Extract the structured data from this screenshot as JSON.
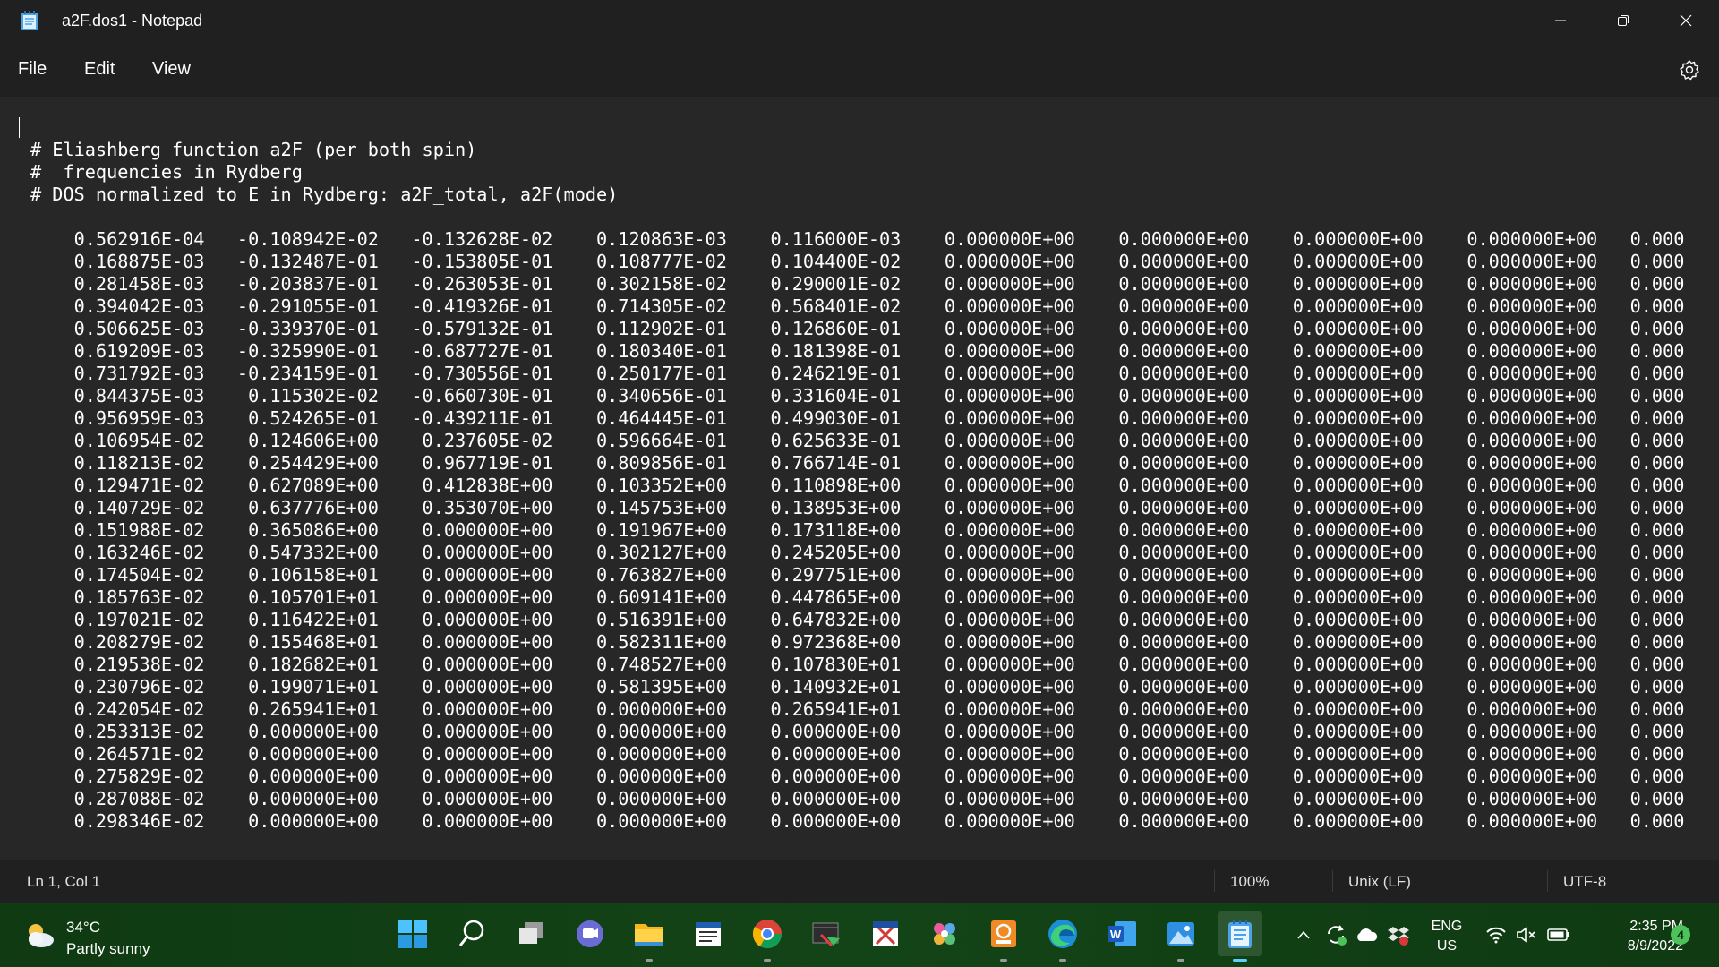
{
  "window": {
    "title": "a2F.dos1 - Notepad"
  },
  "menu": {
    "file": "File",
    "edit": "Edit",
    "view": "View"
  },
  "editor": {
    "header_lines": [
      "# Eliashberg function a2F (per both spin)",
      "#  frequencies in Rydberg",
      "# DOS normalized to E in Rydberg: a2F_total, a2F(mode)"
    ],
    "rows": [
      [
        "0.562916E-04",
        "-0.108942E-02",
        "-0.132628E-02",
        "0.120863E-03",
        "0.116000E-03",
        "0.000000E+00",
        "0.000000E+00",
        "0.000000E+00",
        "0.000000E+00",
        "0.000"
      ],
      [
        "0.168875E-03",
        "-0.132487E-01",
        "-0.153805E-01",
        "0.108777E-02",
        "0.104400E-02",
        "0.000000E+00",
        "0.000000E+00",
        "0.000000E+00",
        "0.000000E+00",
        "0.000"
      ],
      [
        "0.281458E-03",
        "-0.203837E-01",
        "-0.263053E-01",
        "0.302158E-02",
        "0.290001E-02",
        "0.000000E+00",
        "0.000000E+00",
        "0.000000E+00",
        "0.000000E+00",
        "0.000"
      ],
      [
        "0.394042E-03",
        "-0.291055E-01",
        "-0.419326E-01",
        "0.714305E-02",
        "0.568401E-02",
        "0.000000E+00",
        "0.000000E+00",
        "0.000000E+00",
        "0.000000E+00",
        "0.000"
      ],
      [
        "0.506625E-03",
        "-0.339370E-01",
        "-0.579132E-01",
        "0.112902E-01",
        "0.126860E-01",
        "0.000000E+00",
        "0.000000E+00",
        "0.000000E+00",
        "0.000000E+00",
        "0.000"
      ],
      [
        "0.619209E-03",
        "-0.325990E-01",
        "-0.687727E-01",
        "0.180340E-01",
        "0.181398E-01",
        "0.000000E+00",
        "0.000000E+00",
        "0.000000E+00",
        "0.000000E+00",
        "0.000"
      ],
      [
        "0.731792E-03",
        "-0.234159E-01",
        "-0.730556E-01",
        "0.250177E-01",
        "0.246219E-01",
        "0.000000E+00",
        "0.000000E+00",
        "0.000000E+00",
        "0.000000E+00",
        "0.000"
      ],
      [
        "0.844375E-03",
        "0.115302E-02",
        "-0.660730E-01",
        "0.340656E-01",
        "0.331604E-01",
        "0.000000E+00",
        "0.000000E+00",
        "0.000000E+00",
        "0.000000E+00",
        "0.000"
      ],
      [
        "0.956959E-03",
        "0.524265E-01",
        "-0.439211E-01",
        "0.464445E-01",
        "0.499030E-01",
        "0.000000E+00",
        "0.000000E+00",
        "0.000000E+00",
        "0.000000E+00",
        "0.000"
      ],
      [
        "0.106954E-02",
        "0.124606E+00",
        "0.237605E-02",
        "0.596664E-01",
        "0.625633E-01",
        "0.000000E+00",
        "0.000000E+00",
        "0.000000E+00",
        "0.000000E+00",
        "0.000"
      ],
      [
        "0.118213E-02",
        "0.254429E+00",
        "0.967719E-01",
        "0.809856E-01",
        "0.766714E-01",
        "0.000000E+00",
        "0.000000E+00",
        "0.000000E+00",
        "0.000000E+00",
        "0.000"
      ],
      [
        "0.129471E-02",
        "0.627089E+00",
        "0.412838E+00",
        "0.103352E+00",
        "0.110898E+00",
        "0.000000E+00",
        "0.000000E+00",
        "0.000000E+00",
        "0.000000E+00",
        "0.000"
      ],
      [
        "0.140729E-02",
        "0.637776E+00",
        "0.353070E+00",
        "0.145753E+00",
        "0.138953E+00",
        "0.000000E+00",
        "0.000000E+00",
        "0.000000E+00",
        "0.000000E+00",
        "0.000"
      ],
      [
        "0.151988E-02",
        "0.365086E+00",
        "0.000000E+00",
        "0.191967E+00",
        "0.173118E+00",
        "0.000000E+00",
        "0.000000E+00",
        "0.000000E+00",
        "0.000000E+00",
        "0.000"
      ],
      [
        "0.163246E-02",
        "0.547332E+00",
        "0.000000E+00",
        "0.302127E+00",
        "0.245205E+00",
        "0.000000E+00",
        "0.000000E+00",
        "0.000000E+00",
        "0.000000E+00",
        "0.000"
      ],
      [
        "0.174504E-02",
        "0.106158E+01",
        "0.000000E+00",
        "0.763827E+00",
        "0.297751E+00",
        "0.000000E+00",
        "0.000000E+00",
        "0.000000E+00",
        "0.000000E+00",
        "0.000"
      ],
      [
        "0.185763E-02",
        "0.105701E+01",
        "0.000000E+00",
        "0.609141E+00",
        "0.447865E+00",
        "0.000000E+00",
        "0.000000E+00",
        "0.000000E+00",
        "0.000000E+00",
        "0.000"
      ],
      [
        "0.197021E-02",
        "0.116422E+01",
        "0.000000E+00",
        "0.516391E+00",
        "0.647832E+00",
        "0.000000E+00",
        "0.000000E+00",
        "0.000000E+00",
        "0.000000E+00",
        "0.000"
      ],
      [
        "0.208279E-02",
        "0.155468E+01",
        "0.000000E+00",
        "0.582311E+00",
        "0.972368E+00",
        "0.000000E+00",
        "0.000000E+00",
        "0.000000E+00",
        "0.000000E+00",
        "0.000"
      ],
      [
        "0.219538E-02",
        "0.182682E+01",
        "0.000000E+00",
        "0.748527E+00",
        "0.107830E+01",
        "0.000000E+00",
        "0.000000E+00",
        "0.000000E+00",
        "0.000000E+00",
        "0.000"
      ],
      [
        "0.230796E-02",
        "0.199071E+01",
        "0.000000E+00",
        "0.581395E+00",
        "0.140932E+01",
        "0.000000E+00",
        "0.000000E+00",
        "0.000000E+00",
        "0.000000E+00",
        "0.000"
      ],
      [
        "0.242054E-02",
        "0.265941E+01",
        "0.000000E+00",
        "0.000000E+00",
        "0.265941E+01",
        "0.000000E+00",
        "0.000000E+00",
        "0.000000E+00",
        "0.000000E+00",
        "0.000"
      ],
      [
        "0.253313E-02",
        "0.000000E+00",
        "0.000000E+00",
        "0.000000E+00",
        "0.000000E+00",
        "0.000000E+00",
        "0.000000E+00",
        "0.000000E+00",
        "0.000000E+00",
        "0.000"
      ],
      [
        "0.264571E-02",
        "0.000000E+00",
        "0.000000E+00",
        "0.000000E+00",
        "0.000000E+00",
        "0.000000E+00",
        "0.000000E+00",
        "0.000000E+00",
        "0.000000E+00",
        "0.000"
      ],
      [
        "0.275829E-02",
        "0.000000E+00",
        "0.000000E+00",
        "0.000000E+00",
        "0.000000E+00",
        "0.000000E+00",
        "0.000000E+00",
        "0.000000E+00",
        "0.000000E+00",
        "0.000"
      ],
      [
        "0.287088E-02",
        "0.000000E+00",
        "0.000000E+00",
        "0.000000E+00",
        "0.000000E+00",
        "0.000000E+00",
        "0.000000E+00",
        "0.000000E+00",
        "0.000000E+00",
        "0.000"
      ],
      [
        "0.298346E-02",
        "0.000000E+00",
        "0.000000E+00",
        "0.000000E+00",
        "0.000000E+00",
        "0.000000E+00",
        "0.000000E+00",
        "0.000000E+00",
        "0.000000E+00",
        "0.000"
      ]
    ]
  },
  "statusbar": {
    "position": "Ln 1, Col 1",
    "zoom": "100%",
    "line_ending": "Unix (LF)",
    "encoding": "UTF-8"
  },
  "taskbar": {
    "weather_temp": "34°C",
    "weather_desc": "Partly sunny",
    "lang_line1": "ENG",
    "lang_line2": "US",
    "time": "2:35 PM",
    "date": "8/9/2022",
    "notification_count": "4",
    "apps": [
      "start-icon",
      "search-icon",
      "task-view-icon",
      "chat-icon",
      "file-explorer-icon",
      "news-app-icon",
      "chrome-icon",
      "snipping-tool-icon",
      "xps-viewer-icon",
      "pinwheel-app-icon",
      "pdf-app-icon",
      "edge-icon",
      "word-icon",
      "photos-icon",
      "notepad-icon"
    ]
  },
  "colors": {
    "background": "#272727",
    "chrome": "#202020",
    "text": "#ffffff",
    "taskbar": "#134417",
    "accent": "#60cdff"
  }
}
